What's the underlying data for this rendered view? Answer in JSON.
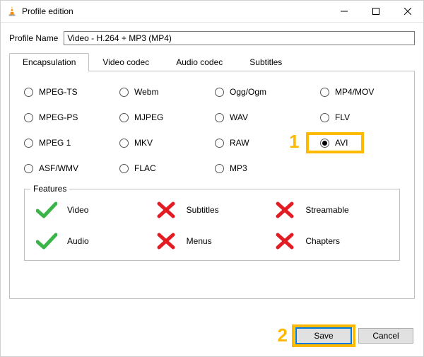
{
  "window": {
    "title": "Profile edition"
  },
  "profile": {
    "label": "Profile Name",
    "value": "Video - H.264 + MP3 (MP4)"
  },
  "tabs": [
    {
      "label": "Encapsulation",
      "active": true
    },
    {
      "label": "Video codec"
    },
    {
      "label": "Audio codec"
    },
    {
      "label": "Subtitles"
    }
  ],
  "encapsulation": {
    "options": [
      "MPEG-TS",
      "Webm",
      "Ogg/Ogm",
      "MP4/MOV",
      "MPEG-PS",
      "MJPEG",
      "WAV",
      "FLV",
      "MPEG 1",
      "MKV",
      "RAW",
      "AVI",
      "ASF/WMV",
      "FLAC",
      "MP3"
    ],
    "selected": "AVI"
  },
  "features": {
    "legend": "Features",
    "items": [
      {
        "label": "Video",
        "ok": true
      },
      {
        "label": "Subtitles",
        "ok": false
      },
      {
        "label": "Streamable",
        "ok": false
      },
      {
        "label": "Audio",
        "ok": true
      },
      {
        "label": "Menus",
        "ok": false
      },
      {
        "label": "Chapters",
        "ok": false
      }
    ]
  },
  "annotations": {
    "n1": "1",
    "n2": "2"
  },
  "buttons": {
    "save": "Save",
    "cancel": "Cancel"
  }
}
